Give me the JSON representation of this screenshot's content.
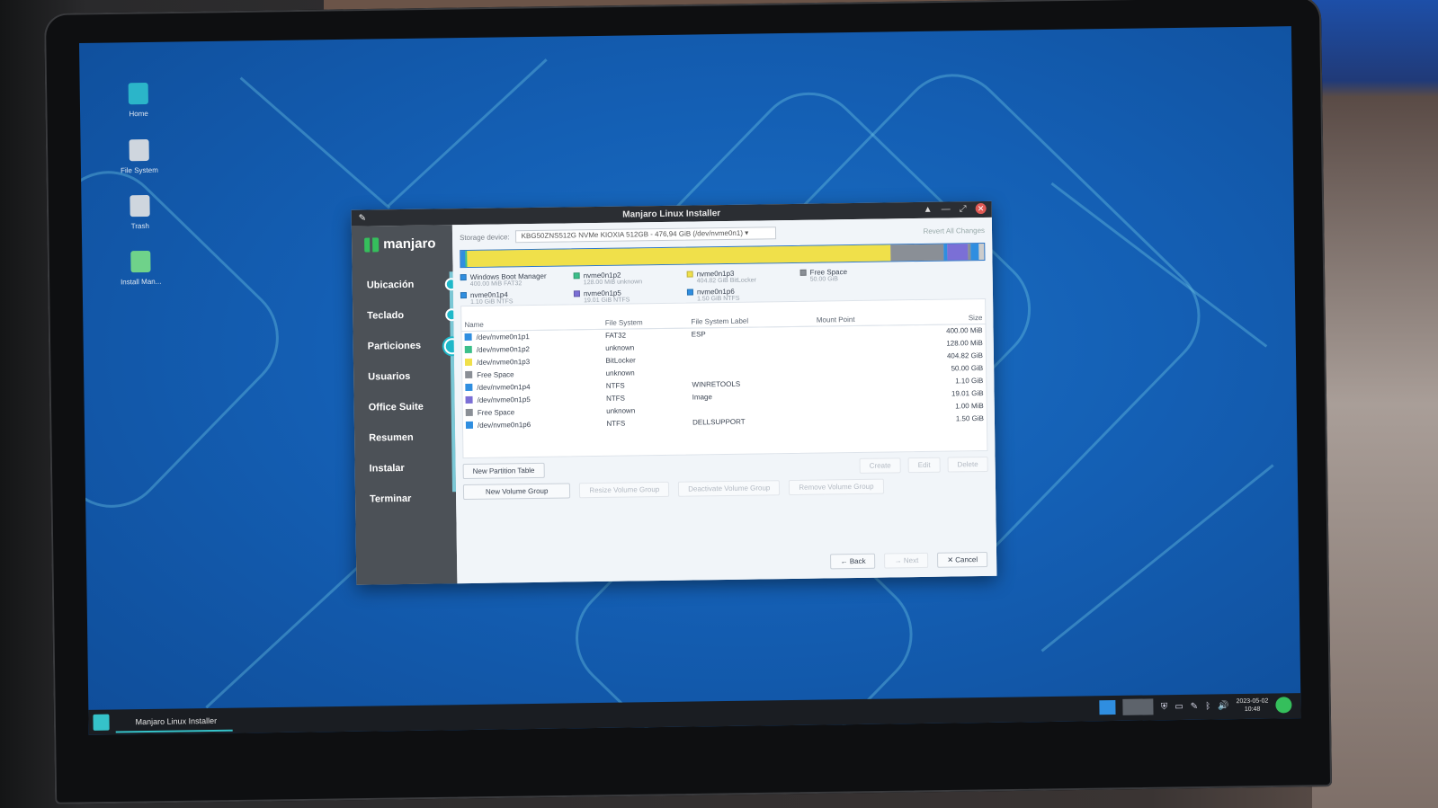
{
  "desktop": {
    "icons": [
      {
        "label": "Home",
        "icon": "home-folder-icon",
        "color": "#2bb5c9"
      },
      {
        "label": "File System",
        "icon": "drive-icon",
        "color": "#cfd6de"
      },
      {
        "label": "Trash",
        "icon": "trash-icon",
        "color": "#cfd6de"
      },
      {
        "label": "Install Man...",
        "icon": "installer-icon",
        "color": "#6fd28a"
      }
    ]
  },
  "window": {
    "title": "Manjaro Linux Installer",
    "logo_text": "manjaro",
    "steps": [
      "Ubicación",
      "Teclado",
      "Particiones",
      "Usuarios",
      "Office Suite",
      "Resumen",
      "Instalar",
      "Terminar"
    ],
    "current_step": "Particiones",
    "storage_label": "Storage device:",
    "storage_value": "KBG50ZNS512G NVMe KIOXIA 512GB - 476,94 GiB (/dev/nvme0n1)",
    "revert_label": "Revert All Changes",
    "legend": [
      {
        "name": "Windows Boot Manager",
        "detail": "400.00 MiB  FAT32",
        "color": "#2f8ee0"
      },
      {
        "name": "nvme0n1p2",
        "detail": "128.00 MiB  unknown",
        "color": "#3bbf8a"
      },
      {
        "name": "nvme0n1p3",
        "detail": "404.82 GiB  BitLocker",
        "color": "#f0e04a"
      },
      {
        "name": "Free Space",
        "detail": "50.00 GiB",
        "color": "#8a8f96"
      },
      {
        "name": "nvme0n1p4",
        "detail": "1.10 GiB  NTFS",
        "color": "#2f8ee0"
      },
      {
        "name": "nvme0n1p5",
        "detail": "19.01 GiB  NTFS",
        "color": "#7b6fd6"
      },
      {
        "name": "nvme0n1p6",
        "detail": "1.50 GiB  NTFS",
        "color": "#2f8ee0"
      }
    ],
    "bar_segments": [
      {
        "fraction": 0.008,
        "color": "#2f8ee0"
      },
      {
        "fraction": 0.004,
        "color": "#3bbf8a"
      },
      {
        "fraction": 0.81,
        "color": "#f0e04a"
      },
      {
        "fraction": 0.1,
        "color": "#8a8f96"
      },
      {
        "fraction": 0.008,
        "color": "#2f8ee0"
      },
      {
        "fraction": 0.04,
        "color": "#7b6fd6"
      },
      {
        "fraction": 0.004,
        "color": "#8a8f96"
      },
      {
        "fraction": 0.016,
        "color": "#2f8ee0"
      }
    ],
    "table": {
      "headers": [
        "Name",
        "File System",
        "File System Label",
        "Mount Point",
        "Size"
      ],
      "rows": [
        {
          "color": "#2f8ee0",
          "name": "/dev/nvme0n1p1",
          "fs": "FAT32",
          "label": "ESP",
          "mount": "",
          "size": "400.00 MiB"
        },
        {
          "color": "#3bbf8a",
          "name": "/dev/nvme0n1p2",
          "fs": "unknown",
          "label": "",
          "mount": "",
          "size": "128.00 MiB"
        },
        {
          "color": "#f0e04a",
          "name": "/dev/nvme0n1p3",
          "fs": "BitLocker",
          "label": "",
          "mount": "",
          "size": "404.82 GiB"
        },
        {
          "color": "#8a8f96",
          "name": "Free Space",
          "fs": "unknown",
          "label": "",
          "mount": "",
          "size": "50.00 GiB"
        },
        {
          "color": "#2f8ee0",
          "name": "/dev/nvme0n1p4",
          "fs": "NTFS",
          "label": "WINRETOOLS",
          "mount": "",
          "size": "1.10 GiB"
        },
        {
          "color": "#7b6fd6",
          "name": "/dev/nvme0n1p5",
          "fs": "NTFS",
          "label": "Image",
          "mount": "",
          "size": "19.01 GiB"
        },
        {
          "color": "#8a8f96",
          "name": "Free Space",
          "fs": "unknown",
          "label": "",
          "mount": "",
          "size": "1.00 MiB"
        },
        {
          "color": "#2f8ee0",
          "name": "/dev/nvme0n1p6",
          "fs": "NTFS",
          "label": "DELLSUPPORT",
          "mount": "",
          "size": "1.50 GiB"
        }
      ]
    },
    "buttons": {
      "new_table": "New Partition Table",
      "create": "Create",
      "edit": "Edit",
      "delete": "Delete",
      "new_vg": "New Volume Group",
      "resize_vg": "Resize Volume Group",
      "deactivate_vg": "Deactivate Volume Group",
      "remove_vg": "Remove Volume Group",
      "back": "Back",
      "next": "Next",
      "cancel": "Cancel"
    }
  },
  "taskbar": {
    "task_label": "Manjaro Linux Installer",
    "clock_date": "2023-05-02",
    "clock_time": "10:48"
  }
}
